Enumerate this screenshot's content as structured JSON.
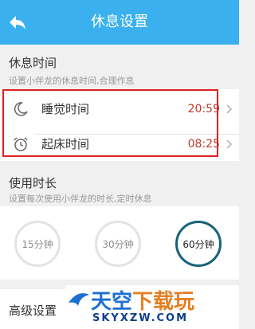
{
  "header": {
    "title": "休息设置"
  },
  "rest_section": {
    "title": "休息时间",
    "desc": "设置小伴龙的休息时间,合理作息",
    "rows": [
      {
        "label": "睡觉时间",
        "value": "20:59",
        "icon": "moon-icon"
      },
      {
        "label": "起床时间",
        "value": "08:25",
        "icon": "alarm-clock-icon"
      }
    ]
  },
  "duration_section": {
    "title": "使用时长",
    "desc": "设置每次使用小伴龙的时长,定时休息",
    "options": [
      "15分钟",
      "30分钟",
      "60分钟"
    ],
    "selected": "60分钟"
  },
  "advanced": {
    "label": "高级设置"
  },
  "watermark": {
    "main_a": "天空",
    "main_b": "下载玩",
    "sub": "SKYXZW.COM"
  },
  "colors": {
    "header": "#3ab0ee",
    "time_value": "#c0392b",
    "highlight_border": "#e02020",
    "selected_ring": "#17627a"
  }
}
